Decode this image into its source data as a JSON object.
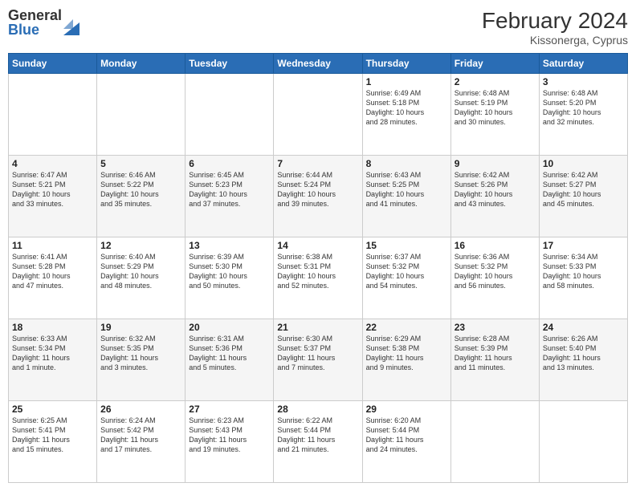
{
  "header": {
    "logo": {
      "general": "General",
      "blue": "Blue"
    },
    "title": "February 2024",
    "location": "Kissonerga, Cyprus"
  },
  "calendar": {
    "days_of_week": [
      "Sunday",
      "Monday",
      "Tuesday",
      "Wednesday",
      "Thursday",
      "Friday",
      "Saturday"
    ],
    "weeks": [
      [
        {
          "day": "",
          "info": ""
        },
        {
          "day": "",
          "info": ""
        },
        {
          "day": "",
          "info": ""
        },
        {
          "day": "",
          "info": ""
        },
        {
          "day": "1",
          "info": "Sunrise: 6:49 AM\nSunset: 5:18 PM\nDaylight: 10 hours\nand 28 minutes."
        },
        {
          "day": "2",
          "info": "Sunrise: 6:48 AM\nSunset: 5:19 PM\nDaylight: 10 hours\nand 30 minutes."
        },
        {
          "day": "3",
          "info": "Sunrise: 6:48 AM\nSunset: 5:20 PM\nDaylight: 10 hours\nand 32 minutes."
        }
      ],
      [
        {
          "day": "4",
          "info": "Sunrise: 6:47 AM\nSunset: 5:21 PM\nDaylight: 10 hours\nand 33 minutes."
        },
        {
          "day": "5",
          "info": "Sunrise: 6:46 AM\nSunset: 5:22 PM\nDaylight: 10 hours\nand 35 minutes."
        },
        {
          "day": "6",
          "info": "Sunrise: 6:45 AM\nSunset: 5:23 PM\nDaylight: 10 hours\nand 37 minutes."
        },
        {
          "day": "7",
          "info": "Sunrise: 6:44 AM\nSunset: 5:24 PM\nDaylight: 10 hours\nand 39 minutes."
        },
        {
          "day": "8",
          "info": "Sunrise: 6:43 AM\nSunset: 5:25 PM\nDaylight: 10 hours\nand 41 minutes."
        },
        {
          "day": "9",
          "info": "Sunrise: 6:42 AM\nSunset: 5:26 PM\nDaylight: 10 hours\nand 43 minutes."
        },
        {
          "day": "10",
          "info": "Sunrise: 6:42 AM\nSunset: 5:27 PM\nDaylight: 10 hours\nand 45 minutes."
        }
      ],
      [
        {
          "day": "11",
          "info": "Sunrise: 6:41 AM\nSunset: 5:28 PM\nDaylight: 10 hours\nand 47 minutes."
        },
        {
          "day": "12",
          "info": "Sunrise: 6:40 AM\nSunset: 5:29 PM\nDaylight: 10 hours\nand 48 minutes."
        },
        {
          "day": "13",
          "info": "Sunrise: 6:39 AM\nSunset: 5:30 PM\nDaylight: 10 hours\nand 50 minutes."
        },
        {
          "day": "14",
          "info": "Sunrise: 6:38 AM\nSunset: 5:31 PM\nDaylight: 10 hours\nand 52 minutes."
        },
        {
          "day": "15",
          "info": "Sunrise: 6:37 AM\nSunset: 5:32 PM\nDaylight: 10 hours\nand 54 minutes."
        },
        {
          "day": "16",
          "info": "Sunrise: 6:36 AM\nSunset: 5:32 PM\nDaylight: 10 hours\nand 56 minutes."
        },
        {
          "day": "17",
          "info": "Sunrise: 6:34 AM\nSunset: 5:33 PM\nDaylight: 10 hours\nand 58 minutes."
        }
      ],
      [
        {
          "day": "18",
          "info": "Sunrise: 6:33 AM\nSunset: 5:34 PM\nDaylight: 11 hours\nand 1 minute."
        },
        {
          "day": "19",
          "info": "Sunrise: 6:32 AM\nSunset: 5:35 PM\nDaylight: 11 hours\nand 3 minutes."
        },
        {
          "day": "20",
          "info": "Sunrise: 6:31 AM\nSunset: 5:36 PM\nDaylight: 11 hours\nand 5 minutes."
        },
        {
          "day": "21",
          "info": "Sunrise: 6:30 AM\nSunset: 5:37 PM\nDaylight: 11 hours\nand 7 minutes."
        },
        {
          "day": "22",
          "info": "Sunrise: 6:29 AM\nSunset: 5:38 PM\nDaylight: 11 hours\nand 9 minutes."
        },
        {
          "day": "23",
          "info": "Sunrise: 6:28 AM\nSunset: 5:39 PM\nDaylight: 11 hours\nand 11 minutes."
        },
        {
          "day": "24",
          "info": "Sunrise: 6:26 AM\nSunset: 5:40 PM\nDaylight: 11 hours\nand 13 minutes."
        }
      ],
      [
        {
          "day": "25",
          "info": "Sunrise: 6:25 AM\nSunset: 5:41 PM\nDaylight: 11 hours\nand 15 minutes."
        },
        {
          "day": "26",
          "info": "Sunrise: 6:24 AM\nSunset: 5:42 PM\nDaylight: 11 hours\nand 17 minutes."
        },
        {
          "day": "27",
          "info": "Sunrise: 6:23 AM\nSunset: 5:43 PM\nDaylight: 11 hours\nand 19 minutes."
        },
        {
          "day": "28",
          "info": "Sunrise: 6:22 AM\nSunset: 5:44 PM\nDaylight: 11 hours\nand 21 minutes."
        },
        {
          "day": "29",
          "info": "Sunrise: 6:20 AM\nSunset: 5:44 PM\nDaylight: 11 hours\nand 24 minutes."
        },
        {
          "day": "",
          "info": ""
        },
        {
          "day": "",
          "info": ""
        }
      ]
    ]
  }
}
